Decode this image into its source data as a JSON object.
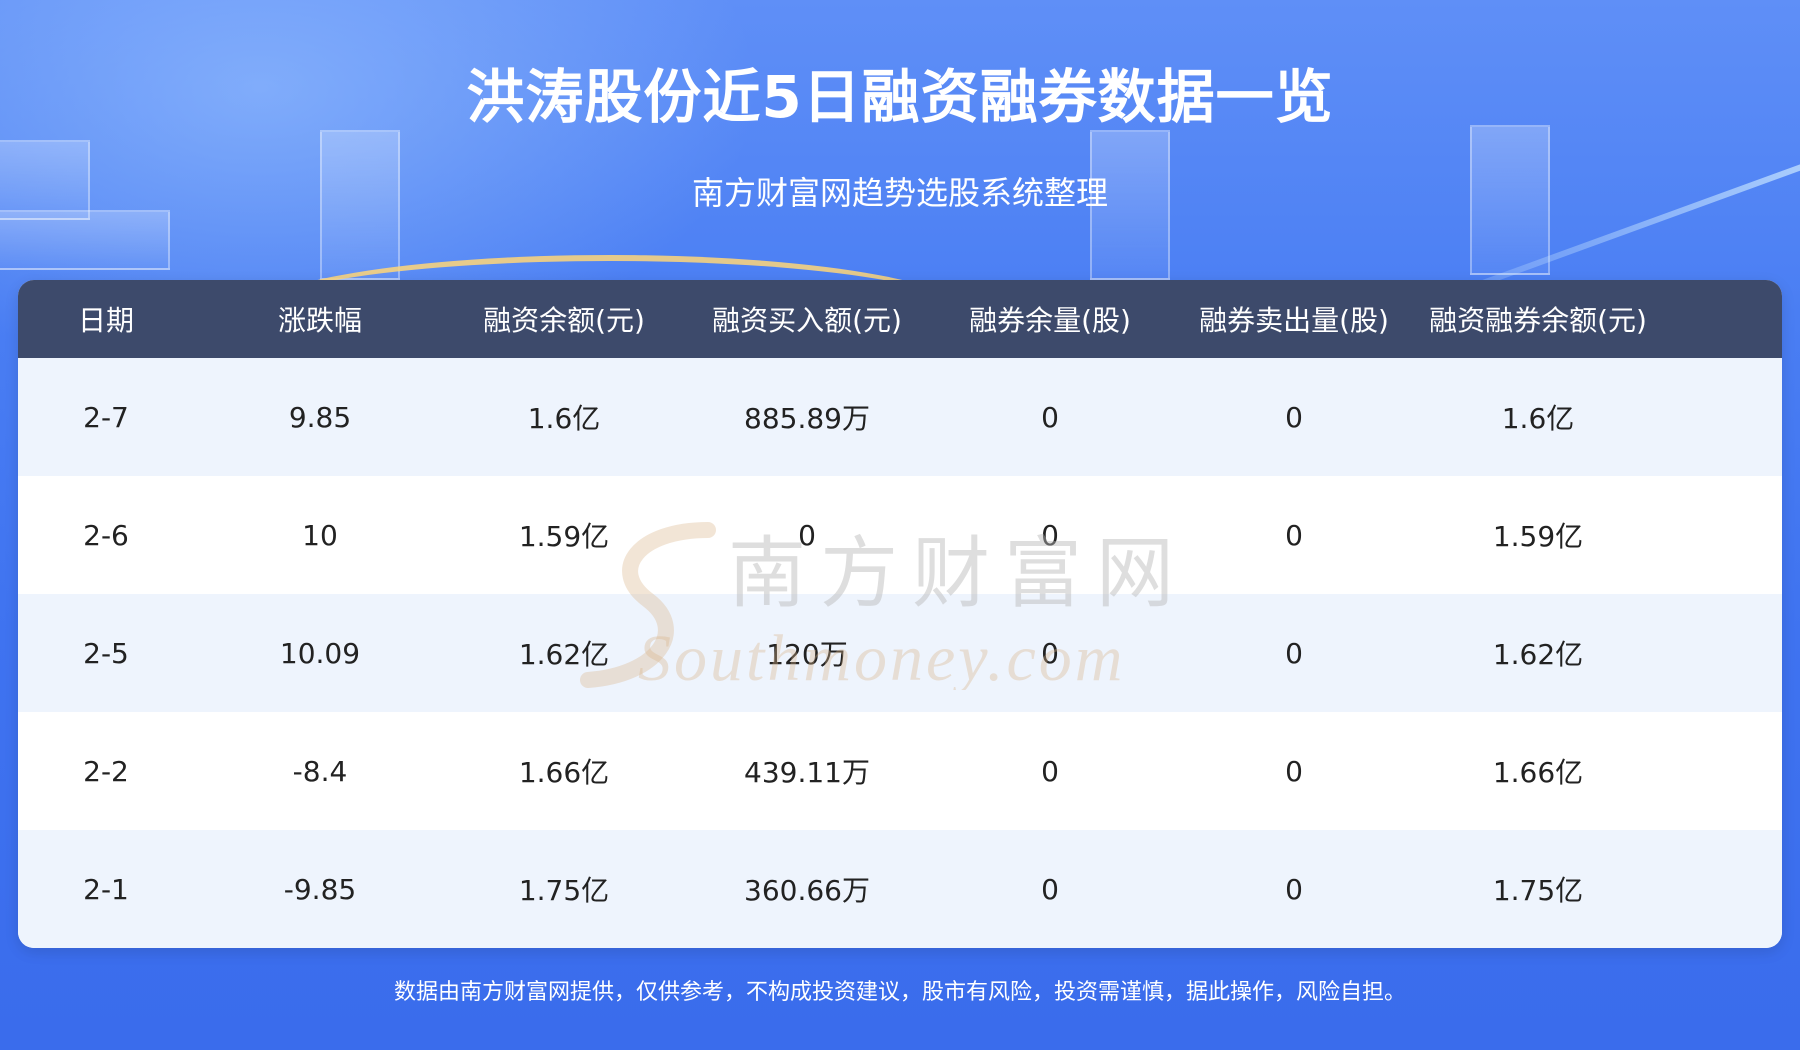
{
  "title": "洪涛股份近5日融资融券数据一览",
  "subtitle": "南方财富网趋势选股系统整理",
  "table": {
    "headers": [
      "日期",
      "涨跌幅",
      "融资余额(元)",
      "融资买入额(元)",
      "融券余量(股)",
      "融券卖出量(股)",
      "融资融券余额(元)"
    ],
    "rows": [
      [
        "2-7",
        "9.85",
        "1.6亿",
        "885.89万",
        "0",
        "0",
        "1.6亿"
      ],
      [
        "2-6",
        "10",
        "1.59亿",
        "0",
        "0",
        "0",
        "1.59亿"
      ],
      [
        "2-5",
        "10.09",
        "1.62亿",
        "120万",
        "0",
        "0",
        "1.62亿"
      ],
      [
        "2-2",
        "-8.4",
        "1.66亿",
        "439.11万",
        "0",
        "0",
        "1.66亿"
      ],
      [
        "2-1",
        "-9.85",
        "1.75亿",
        "360.66万",
        "0",
        "0",
        "1.75亿"
      ]
    ]
  },
  "watermark": {
    "cn": "南方财富网",
    "en": "Southmoney.com"
  },
  "footer": "数据由南方财富网提供，仅供参考，不构成投资建议，股市有风险，投资需谨慎，据此操作，风险自担。",
  "colors": {
    "background": "#4a7ef3",
    "header_row": "#3d4a6b",
    "row_alt": "#eef4fd",
    "watermark": "#c9a27a"
  }
}
